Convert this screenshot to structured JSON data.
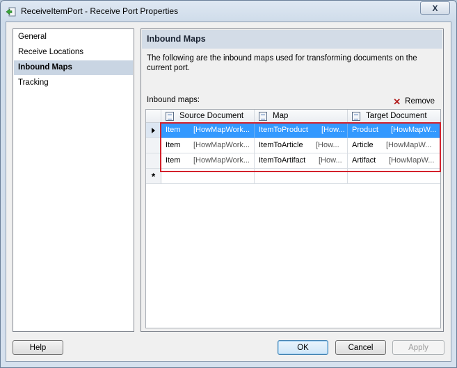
{
  "window": {
    "title": "ReceiveItemPort - Receive Port Properties",
    "close_label": "X"
  },
  "nav": {
    "items": [
      {
        "label": "General"
      },
      {
        "label": "Receive Locations"
      },
      {
        "label": "Inbound Maps",
        "selected": true
      },
      {
        "label": "Tracking"
      }
    ]
  },
  "panel": {
    "header": "Inbound Maps",
    "description": "The following are the inbound maps used for transforming documents on the current port.",
    "grid_label": "Inbound maps:",
    "remove_label": "Remove"
  },
  "grid": {
    "columns": [
      "Source Document",
      "Map",
      "Target Document"
    ],
    "rows": [
      {
        "src": "Item",
        "src_asm": "[HowMapWork...",
        "map": "ItemToProduct",
        "map_asm": "[How...",
        "tgt": "Product",
        "tgt_asm": "[HowMapW...",
        "selected": true
      },
      {
        "src": "Item",
        "src_asm": "[HowMapWork...",
        "map": "ItemToArticle",
        "map_asm": "[How...",
        "tgt": "Article",
        "tgt_asm": "[HowMapW..."
      },
      {
        "src": "Item",
        "src_asm": "[HowMapWork...",
        "map": "ItemToArtifact",
        "map_asm": "[How...",
        "tgt": "Artifact",
        "tgt_asm": "[HowMapW..."
      }
    ],
    "new_row_marker": "*"
  },
  "buttons": {
    "help": "Help",
    "ok": "OK",
    "cancel": "Cancel",
    "apply": "Apply"
  },
  "colors": {
    "selection": "#3399ff",
    "highlight_box": "#d3212b"
  }
}
